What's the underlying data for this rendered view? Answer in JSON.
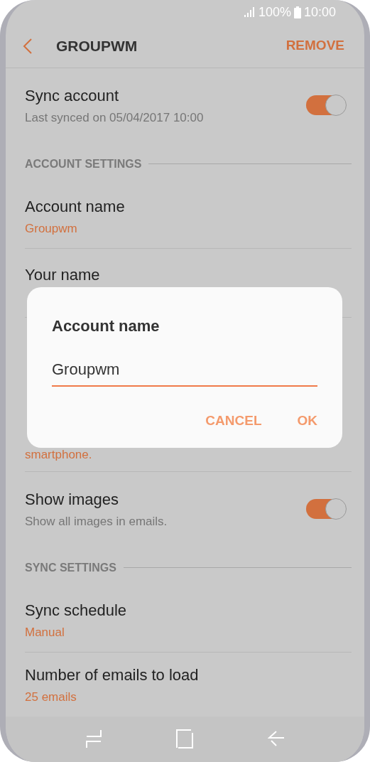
{
  "status_bar": {
    "battery": "100%",
    "time": "10:00"
  },
  "header": {
    "title": "GROUPWM",
    "action": "REMOVE"
  },
  "items": [
    {
      "kind": "toggle",
      "title": "Sync account",
      "subtitle": "Last synced on 05/04/2017  10:00",
      "on": true
    },
    {
      "kind": "section",
      "title": "ACCOUNT SETTINGS"
    },
    {
      "kind": "row",
      "title": "Account name",
      "subtitle": "Groupwm"
    },
    {
      "kind": "row",
      "title": "Your name"
    },
    {
      "kind": "row",
      "subtitle": "smartphone."
    },
    {
      "kind": "toggle",
      "title": "Show images",
      "subtitle": "Show all images in emails.",
      "on": true
    },
    {
      "kind": "section",
      "title": "SYNC SETTINGS"
    },
    {
      "kind": "row",
      "title": "Sync schedule",
      "subtitle": "Manual"
    },
    {
      "kind": "row",
      "title": "Number of emails to load",
      "subtitle": "25 emails"
    }
  ],
  "dialog": {
    "title": "Account name",
    "value": "Groupwm",
    "buttons": [
      "CANCEL",
      "OK"
    ]
  }
}
